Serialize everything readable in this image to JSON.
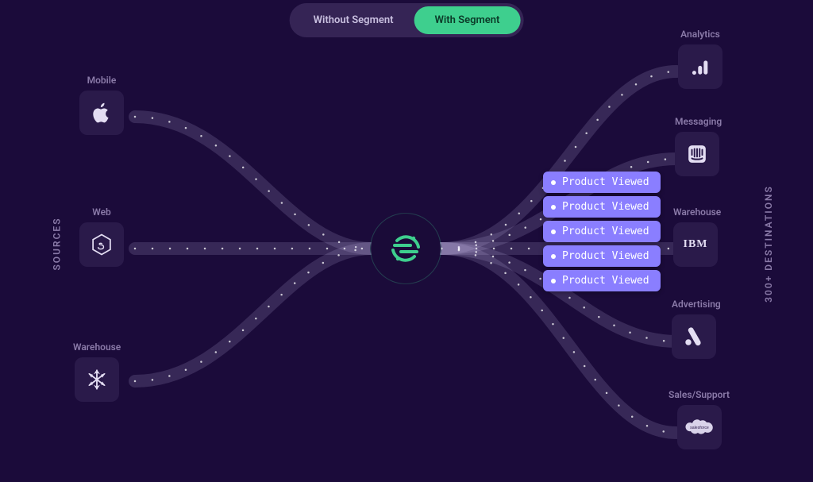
{
  "toggle": {
    "without": "Without Segment",
    "with": "With Segment"
  },
  "labels": {
    "sources": "SOURCES",
    "destinations": "300+ DESTINATIONS"
  },
  "sources": {
    "mobile": {
      "label": "Mobile",
      "icon": "apple-icon"
    },
    "web": {
      "label": "Web",
      "icon": "nodejs-icon"
    },
    "warehouse": {
      "label": "Warehouse",
      "icon": "snowflake-icon"
    }
  },
  "destinations": {
    "analytics": {
      "label": "Analytics",
      "icon": "bar-chart-icon"
    },
    "messaging": {
      "label": "Messaging",
      "icon": "intercom-icon"
    },
    "warehouse": {
      "label": "Warehouse",
      "icon": "ibm-icon",
      "text": "IBM"
    },
    "advertising": {
      "label": "Advertising",
      "icon": "google-ads-icon"
    },
    "sales": {
      "label": "Sales/Support",
      "icon": "salesforce-icon",
      "text": "salesforce"
    }
  },
  "events": [
    "Product Viewed",
    "Product Viewed",
    "Product Viewed",
    "Product Viewed",
    "Product Viewed"
  ]
}
